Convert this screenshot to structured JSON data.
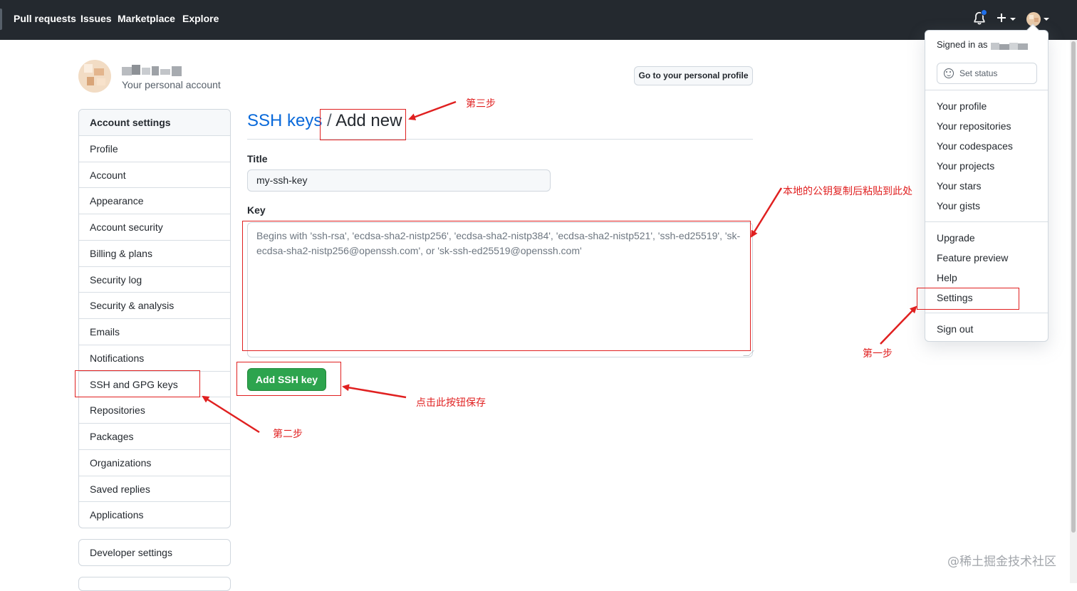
{
  "header": {
    "nav": [
      "Pull requests",
      "Issues",
      "Marketplace",
      "Explore"
    ],
    "icons": [
      "bell-icon",
      "plus-icon",
      "avatar"
    ]
  },
  "profile": {
    "subtitle": "Your personal account",
    "go_profile_label": "Go to your personal profile"
  },
  "sidebar": {
    "items": [
      {
        "label": "Account settings"
      },
      {
        "label": "Profile"
      },
      {
        "label": "Account"
      },
      {
        "label": "Appearance"
      },
      {
        "label": "Account security"
      },
      {
        "label": "Billing & plans"
      },
      {
        "label": "Security log"
      },
      {
        "label": "Security & analysis"
      },
      {
        "label": "Emails"
      },
      {
        "label": "Notifications"
      },
      {
        "label": "SSH and GPG keys"
      },
      {
        "label": "Repositories"
      },
      {
        "label": "Packages"
      },
      {
        "label": "Organizations"
      },
      {
        "label": "Saved replies"
      },
      {
        "label": "Applications"
      }
    ],
    "developer_settings": "Developer settings"
  },
  "main": {
    "breadcrumb": "SSH keys",
    "separator": "/",
    "current": "Add new",
    "title_label": "Title",
    "title_value": "my-ssh-key",
    "key_label": "Key",
    "key_placeholder": "Begins with 'ssh-rsa', 'ecdsa-sha2-nistp256', 'ecdsa-sha2-nistp384', 'ecdsa-sha2-nistp521', 'ssh-ed25519', 'sk-ecdsa-sha2-nistp256@openssh.com', or 'sk-ssh-ed25519@openssh.com'",
    "submit_label": "Add SSH key"
  },
  "dropdown": {
    "signed_in": "Signed in as",
    "set_status": "Set status",
    "group1": [
      "Your profile",
      "Your repositories",
      "Your codespaces",
      "Your projects",
      "Your stars",
      "Your gists"
    ],
    "group2": [
      "Upgrade",
      "Feature preview",
      "Help",
      "Settings"
    ],
    "sign_out": "Sign out"
  },
  "annotations": {
    "step1": "第一步",
    "step2": "第二步",
    "step3": "第三步",
    "paste_note": "本地的公钥复制后粘贴到此处",
    "save_note": "点击此按钮保存",
    "color": "#e02020"
  },
  "watermark": "@稀土掘金技术社区",
  "colors": {
    "header_bg": "#24292f",
    "link_blue": "#0969da",
    "button_green": "#2da44e",
    "annotation_red": "#e02020"
  }
}
